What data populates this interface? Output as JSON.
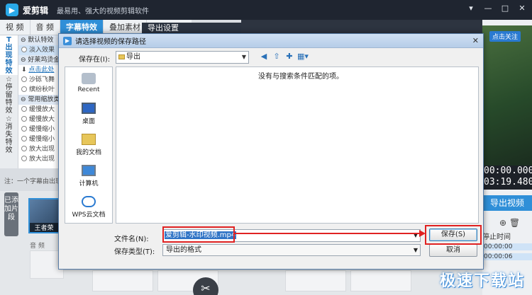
{
  "app": {
    "name": "爱剪辑",
    "slogan": "最易用、强大的视频剪辑软件",
    "window_controls": [
      "▾",
      "—",
      "□",
      "✕"
    ]
  },
  "main_tabs": [
    {
      "label": "视 频",
      "active": false
    },
    {
      "label": "音 频",
      "active": false
    },
    {
      "label": "字幕特效",
      "active": true
    },
    {
      "label": "叠加素材",
      "active": false
    }
  ],
  "side_tabs": [
    {
      "label": "出现特效",
      "icon": "T",
      "active": true
    },
    {
      "label": "停留特效",
      "icon": "☆",
      "active": false
    },
    {
      "label": "消失特效",
      "icon": "☆",
      "active": false
    }
  ],
  "effect_list": [
    {
      "type": "group",
      "label": "默认特效"
    },
    {
      "type": "item",
      "label": "淡入效果",
      "selected": true
    },
    {
      "type": "group",
      "label": "好莱坞烫金"
    },
    {
      "type": "link",
      "label": "点击此处"
    },
    {
      "type": "item",
      "label": "沙砾飞舞"
    },
    {
      "type": "item",
      "label": "缤纷秋叶"
    },
    {
      "type": "group",
      "label": "常用缩放类"
    },
    {
      "type": "item",
      "label": "缓慢放大"
    },
    {
      "type": "item",
      "label": "缓慢放大"
    },
    {
      "type": "item",
      "label": "缓慢缩小"
    },
    {
      "type": "item",
      "label": "缓慢缩小"
    },
    {
      "type": "item",
      "label": "放大出现"
    },
    {
      "type": "item",
      "label": "放大出现"
    }
  ],
  "tip": "注：一个字幕由出现",
  "added_clips_tab": "已添加片段",
  "thumb_label": "王者荣",
  "audio_label": "音 频",
  "export_settings_title": "导出设置",
  "preview": {
    "banner": "点击关注",
    "time_current": "00:00.000",
    "time_total": "03:19.480"
  },
  "export_button": "导出视频",
  "right_list": {
    "header": "停止时间",
    "rows": [
      "00:00:00",
      "00:00:06"
    ]
  },
  "dialog": {
    "title": "请选择视频的保存路径",
    "look_in_label": "保存在(I):",
    "look_in_value": "导出",
    "places": [
      {
        "label": "Recent",
        "icon": "recent-icon"
      },
      {
        "label": "桌面",
        "icon": "desktop-icon"
      },
      {
        "label": "我的文档",
        "icon": "documents-icon"
      },
      {
        "label": "计算机",
        "icon": "computer-icon"
      },
      {
        "label": "WPS云文档",
        "icon": "cloud-icon"
      }
    ],
    "empty_message": "没有与搜索条件匹配的项。",
    "filename_label": "文件名(N):",
    "filename_value": "爱剪辑-水印视频.mp4",
    "filetype_label": "保存类型(T):",
    "filetype_value": "导出的格式",
    "save_button": "保存(S)",
    "cancel_button": "取消"
  },
  "watermark": "极速下载站",
  "annotation_color": "#e02222"
}
